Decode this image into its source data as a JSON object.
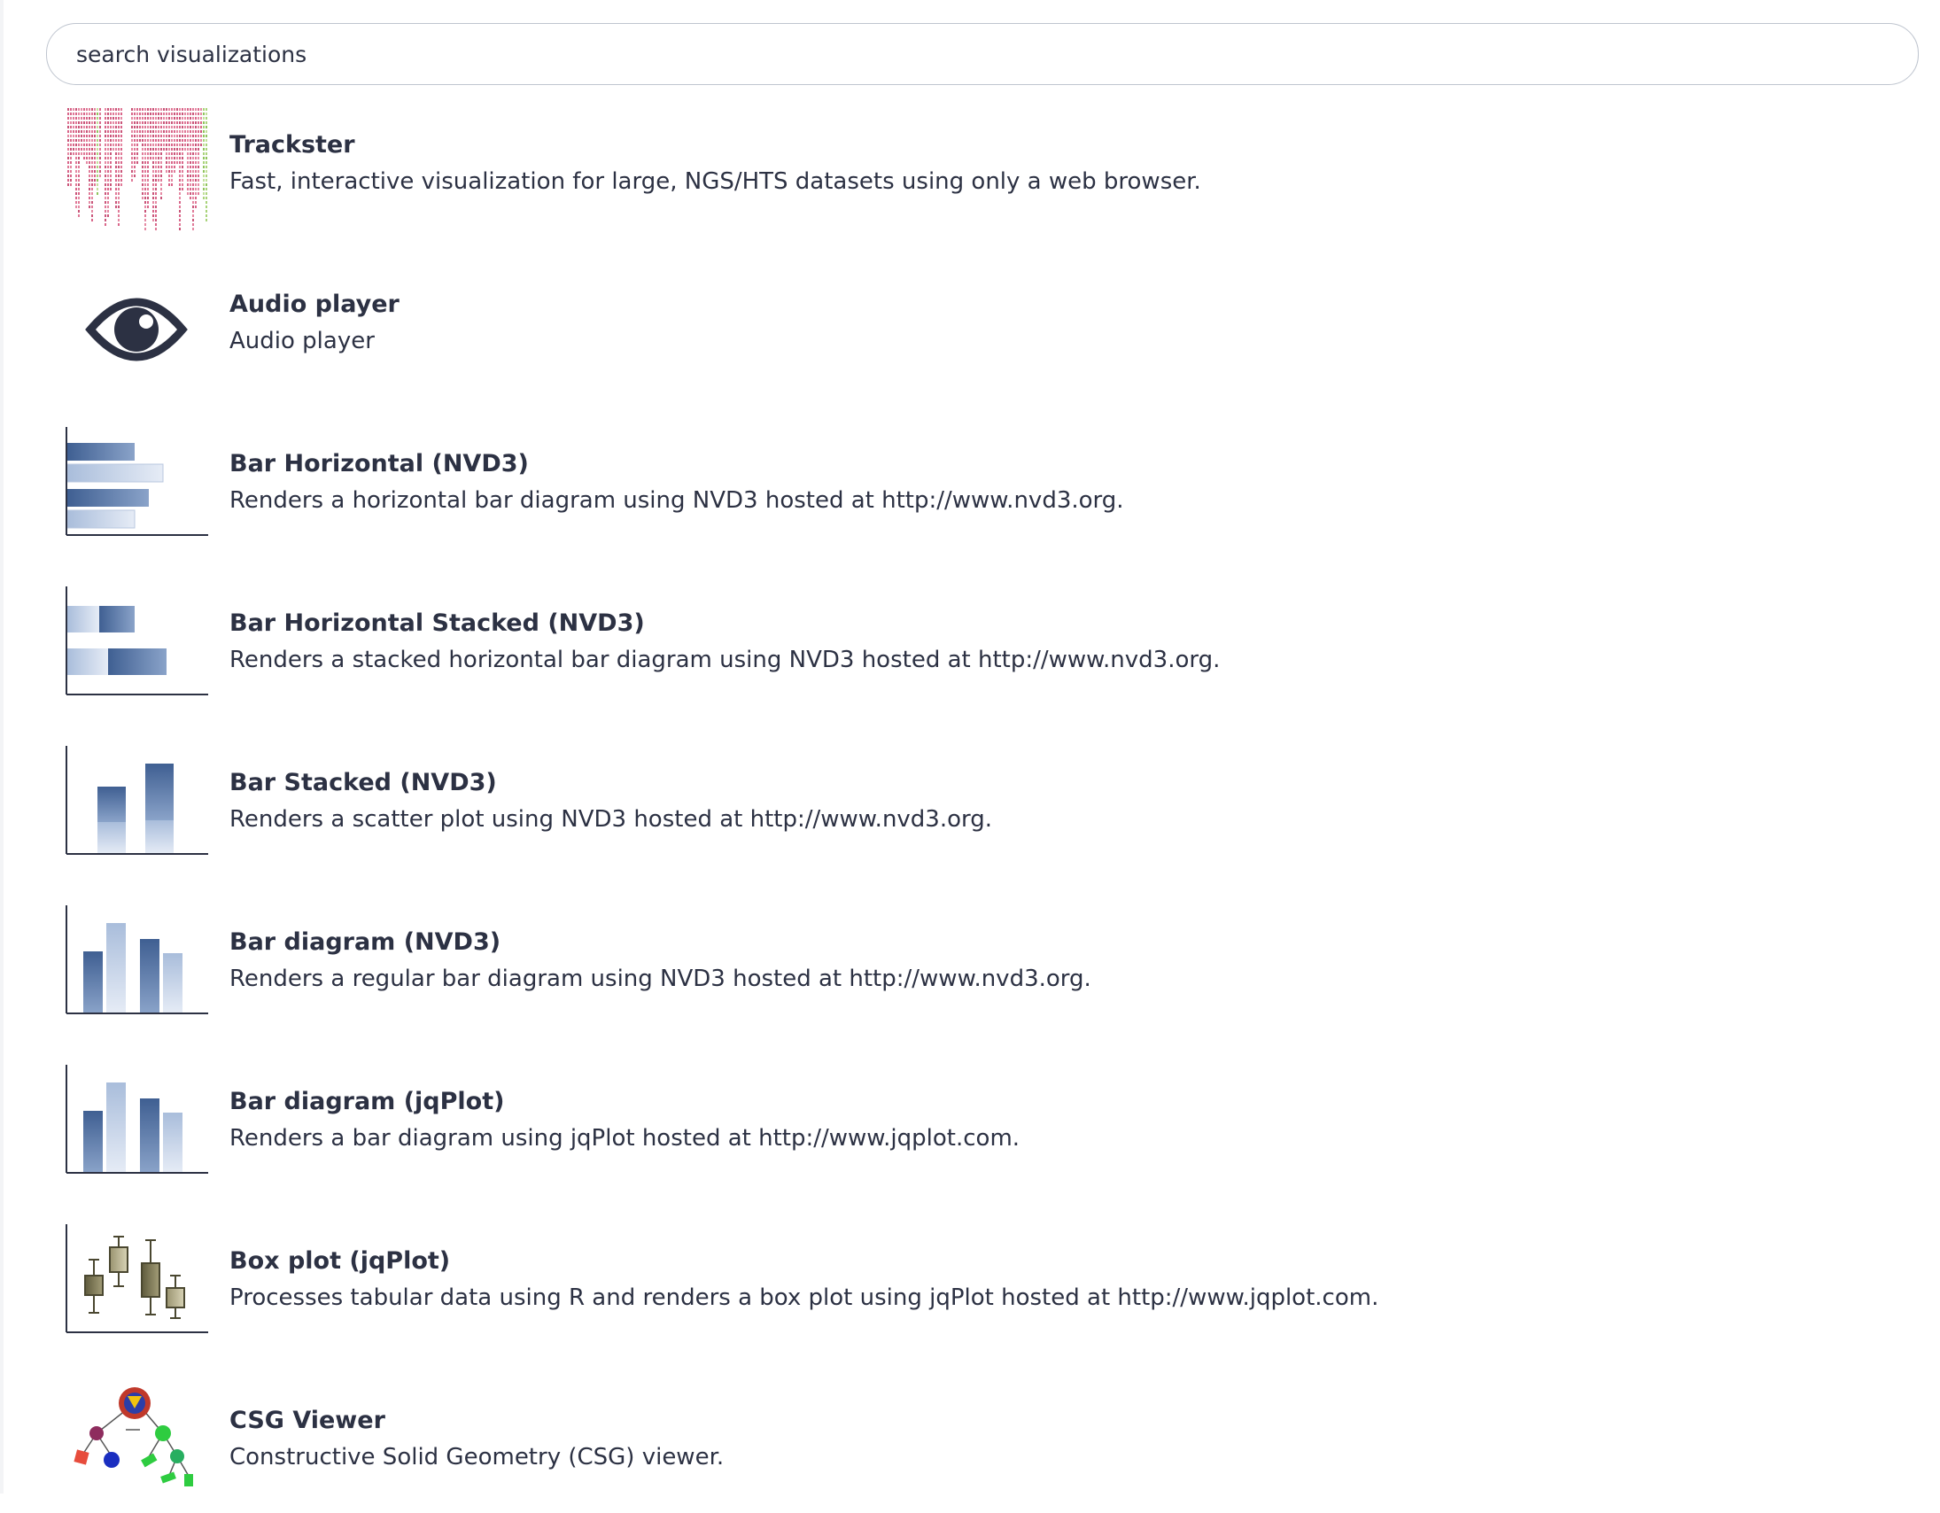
{
  "search": {
    "placeholder": "search visualizations",
    "value": ""
  },
  "items": [
    {
      "title": "Trackster",
      "description": "Fast, interactive visualization for large, NGS/HTS datasets using only a web browser.",
      "icon": "trackster-thumbnail"
    },
    {
      "title": "Audio player",
      "description": "Audio player",
      "icon": "eye-icon"
    },
    {
      "title": "Bar Horizontal (NVD3)",
      "description": "Renders a horizontal bar diagram using NVD3 hosted at http://www.nvd3.org.",
      "icon": "bar-horizontal-thumbnail"
    },
    {
      "title": "Bar Horizontal Stacked (NVD3)",
      "description": "Renders a stacked horizontal bar diagram using NVD3 hosted at http://www.nvd3.org.",
      "icon": "bar-horizontal-stacked-thumbnail"
    },
    {
      "title": "Bar Stacked (NVD3)",
      "description": "Renders a scatter plot using NVD3 hosted at http://www.nvd3.org.",
      "icon": "bar-stacked-thumbnail"
    },
    {
      "title": "Bar diagram (NVD3)",
      "description": "Renders a regular bar diagram using NVD3 hosted at http://www.nvd3.org.",
      "icon": "bar-diagram-thumbnail"
    },
    {
      "title": "Bar diagram (jqPlot)",
      "description": "Renders a bar diagram using jqPlot hosted at http://www.jqplot.com.",
      "icon": "bar-diagram-thumbnail"
    },
    {
      "title": "Box plot (jqPlot)",
      "description": "Processes tabular data using R and renders a box plot using jqPlot hosted at http://www.jqplot.com.",
      "icon": "box-plot-thumbnail"
    },
    {
      "title": "CSG Viewer",
      "description": "Constructive Solid Geometry (CSG) viewer.",
      "icon": "csg-viewer-thumbnail"
    }
  ],
  "colors": {
    "text": "#2c3143",
    "search_border": "#bfc5cf",
    "bar_dark": "#4a6a9c",
    "bar_light": "#c9d6ea"
  }
}
